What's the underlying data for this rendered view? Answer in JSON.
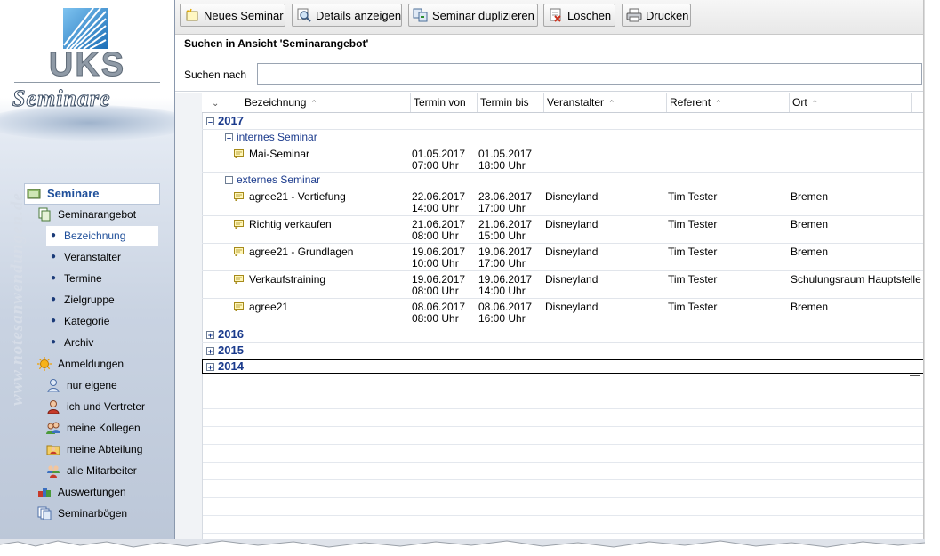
{
  "logo": {
    "brand": "UKS",
    "subtitle": "Seminare",
    "watermark": "www.notesanwendungen.de"
  },
  "sidebar": {
    "root": "Seminare",
    "items": [
      {
        "label": "Seminarangebot",
        "icon": "document-icon",
        "level": 1
      },
      {
        "label": "Bezeichnung",
        "icon": "bullet",
        "level": 2,
        "selected": true
      },
      {
        "label": "Veranstalter",
        "icon": "bullet",
        "level": 2
      },
      {
        "label": "Termine",
        "icon": "bullet",
        "level": 2
      },
      {
        "label": "Zielgruppe",
        "icon": "bullet",
        "level": 2
      },
      {
        "label": "Kategorie",
        "icon": "bullet",
        "level": 2
      },
      {
        "label": "Archiv",
        "icon": "bullet",
        "level": 2
      },
      {
        "label": "Anmeldungen",
        "icon": "sun-icon",
        "level": 1
      },
      {
        "label": "nur eigene",
        "icon": "user-icon",
        "level": 2
      },
      {
        "label": "ich und Vertreter",
        "icon": "user-red-icon",
        "level": 2
      },
      {
        "label": "meine Kollegen",
        "icon": "users-icon",
        "level": 2
      },
      {
        "label": "meine Abteilung",
        "icon": "folder-users-icon",
        "level": 2
      },
      {
        "label": "alle Mitarbeiter",
        "icon": "group-icon",
        "level": 2
      },
      {
        "label": "Auswertungen",
        "icon": "cubes-icon",
        "level": 1
      },
      {
        "label": "Seminarbögen",
        "icon": "pages-icon",
        "level": 1
      }
    ]
  },
  "toolbar": {
    "new": "Neues Seminar",
    "details": "Details anzeigen",
    "duplicate": "Seminar duplizieren",
    "delete": "Löschen",
    "print": "Drucken"
  },
  "view": {
    "title": "Suchen in Ansicht 'Seminarangebot'",
    "search_label": "Suchen nach",
    "search_value": ""
  },
  "columns": [
    "Bezeichnung",
    "Termin von",
    "Termin bis",
    "Veranstalter",
    "Referent",
    "Ort"
  ],
  "groups": {
    "y2017": "2017",
    "intern": "internes Seminar",
    "extern": "externes Seminar",
    "y2016": "2016",
    "y2015": "2015",
    "y2014": "2014"
  },
  "rows": [
    {
      "name": "Mai-Seminar",
      "von_d": "01.05.2017",
      "von_t": "07:00 Uhr",
      "bis_d": "01.05.2017",
      "bis_t": "18:00 Uhr",
      "veranstalter": "",
      "referent": "",
      "ort": ""
    },
    {
      "name": "agree21 - Vertiefung",
      "von_d": "22.06.2017",
      "von_t": "14:00 Uhr",
      "bis_d": "23.06.2017",
      "bis_t": "17:00 Uhr",
      "veranstalter": "Disneyland",
      "referent": "Tim Tester",
      "ort": "Bremen"
    },
    {
      "name": "Richtig verkaufen",
      "von_d": "21.06.2017",
      "von_t": "08:00 Uhr",
      "bis_d": "21.06.2017",
      "bis_t": "15:00 Uhr",
      "veranstalter": "Disneyland",
      "referent": "Tim Tester",
      "ort": "Bremen"
    },
    {
      "name": "agree21 - Grundlagen",
      "von_d": "19.06.2017",
      "von_t": "10:00 Uhr",
      "bis_d": "19.06.2017",
      "bis_t": "17:00 Uhr",
      "veranstalter": "Disneyland",
      "referent": "Tim Tester",
      "ort": "Bremen"
    },
    {
      "name": "Verkaufstraining",
      "von_d": "19.06.2017",
      "von_t": "08:00 Uhr",
      "bis_d": "19.06.2017",
      "bis_t": "14:00 Uhr",
      "veranstalter": "Disneyland",
      "referent": "Tim Tester",
      "ort": "Schulungsraum Hauptstelle"
    },
    {
      "name": "agree21",
      "von_d": "08.06.2017",
      "von_t": "08:00 Uhr",
      "bis_d": "08.06.2017",
      "bis_t": "16:00 Uhr",
      "veranstalter": "Disneyland",
      "referent": "Tim Tester",
      "ort": "Bremen"
    }
  ]
}
